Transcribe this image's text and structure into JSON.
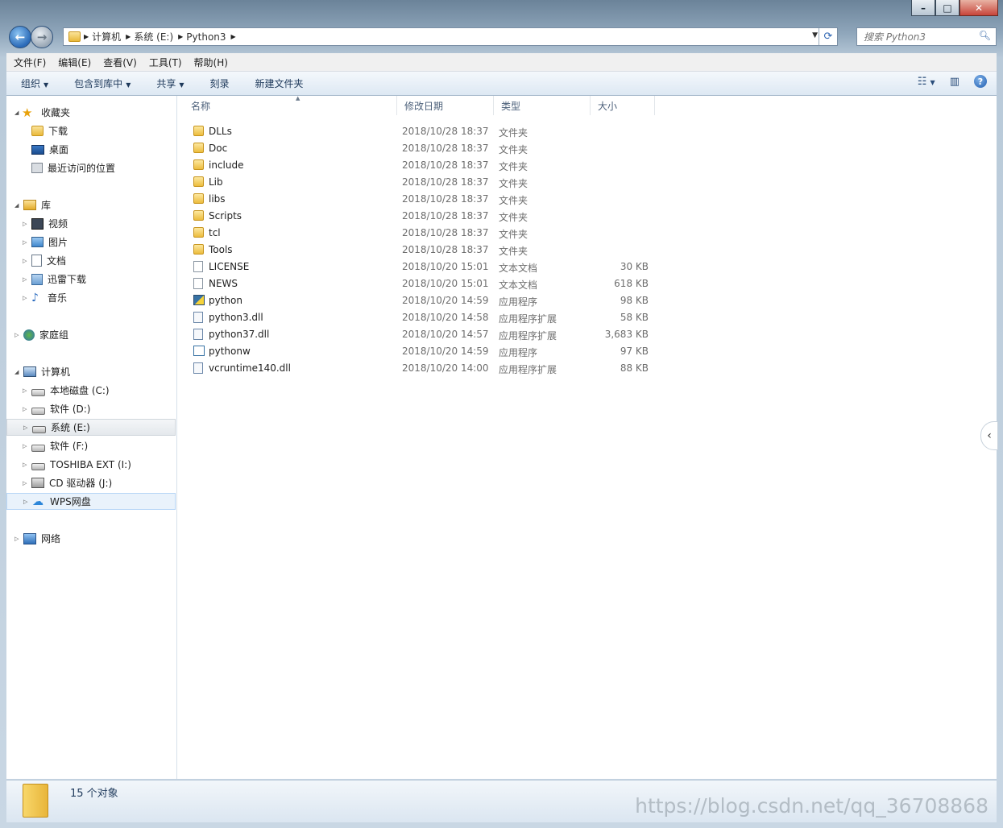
{
  "window": {
    "minimize": "–",
    "maximize": "□",
    "close": "✕"
  },
  "address": {
    "segments": [
      "计算机",
      "系统 (E:)",
      "Python3"
    ],
    "search_placeholder": "搜索 Python3"
  },
  "menu": [
    "文件(F)",
    "编辑(E)",
    "查看(V)",
    "工具(T)",
    "帮助(H)"
  ],
  "toolbar": {
    "organize": "组织",
    "include_in_library": "包含到库中",
    "share": "共享",
    "burn": "刻录",
    "new_folder": "新建文件夹",
    "help": "?"
  },
  "nav": {
    "favorites": "收藏夹",
    "downloads": "下载",
    "desktop": "桌面",
    "recent": "最近访问的位置",
    "libraries": "库",
    "videos": "视频",
    "pictures": "图片",
    "documents": "文档",
    "xunlei": "迅雷下载",
    "music": "音乐",
    "homegroup": "家庭组",
    "computer": "计算机",
    "drive_c": "本地磁盘 (C:)",
    "drive_d": "软件 (D:)",
    "drive_e": "系统 (E:)",
    "drive_f": "软件 (F:)",
    "drive_i": "TOSHIBA EXT (I:)",
    "drive_j": "CD 驱动器 (J:)",
    "wps": "WPS网盘",
    "network": "网络"
  },
  "columns": {
    "name": "名称",
    "date": "修改日期",
    "type": "类型",
    "size": "大小"
  },
  "files": [
    {
      "name": "DLLs",
      "date": "2018/10/28 18:37",
      "type": "文件夹",
      "size": "",
      "icon": "folder"
    },
    {
      "name": "Doc",
      "date": "2018/10/28 18:37",
      "type": "文件夹",
      "size": "",
      "icon": "folder"
    },
    {
      "name": "include",
      "date": "2018/10/28 18:37",
      "type": "文件夹",
      "size": "",
      "icon": "folder"
    },
    {
      "name": "Lib",
      "date": "2018/10/28 18:37",
      "type": "文件夹",
      "size": "",
      "icon": "folder"
    },
    {
      "name": "libs",
      "date": "2018/10/28 18:37",
      "type": "文件夹",
      "size": "",
      "icon": "folder"
    },
    {
      "name": "Scripts",
      "date": "2018/10/28 18:37",
      "type": "文件夹",
      "size": "",
      "icon": "folder"
    },
    {
      "name": "tcl",
      "date": "2018/10/28 18:37",
      "type": "文件夹",
      "size": "",
      "icon": "folder"
    },
    {
      "name": "Tools",
      "date": "2018/10/28 18:37",
      "type": "文件夹",
      "size": "",
      "icon": "folder"
    },
    {
      "name": "LICENSE",
      "date": "2018/10/20 15:01",
      "type": "文本文档",
      "size": "30 KB",
      "icon": "text"
    },
    {
      "name": "NEWS",
      "date": "2018/10/20 15:01",
      "type": "文本文档",
      "size": "618 KB",
      "icon": "text"
    },
    {
      "name": "python",
      "date": "2018/10/20 14:59",
      "type": "应用程序",
      "size": "98 KB",
      "icon": "exe"
    },
    {
      "name": "python3.dll",
      "date": "2018/10/20 14:58",
      "type": "应用程序扩展",
      "size": "58 KB",
      "icon": "dll"
    },
    {
      "name": "python37.dll",
      "date": "2018/10/20 14:57",
      "type": "应用程序扩展",
      "size": "3,683 KB",
      "icon": "dll"
    },
    {
      "name": "pythonw",
      "date": "2018/10/20 14:59",
      "type": "应用程序",
      "size": "97 KB",
      "icon": "exew"
    },
    {
      "name": "vcruntime140.dll",
      "date": "2018/10/20 14:00",
      "type": "应用程序扩展",
      "size": "88 KB",
      "icon": "dll"
    }
  ],
  "status": {
    "count": "15 个对象"
  },
  "watermark": "https://blog.csdn.net/qq_36708868"
}
